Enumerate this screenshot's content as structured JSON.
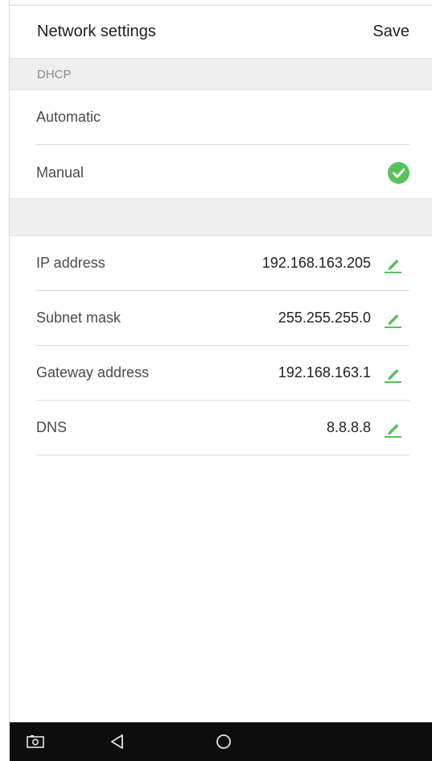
{
  "header": {
    "title": "Network settings",
    "save_label": "Save"
  },
  "dhcp_section": {
    "label": "DHCP",
    "options": [
      {
        "label": "Automatic",
        "selected": false
      },
      {
        "label": "Manual",
        "selected": true
      }
    ]
  },
  "network_fields": [
    {
      "label": "IP address",
      "value": "192.168.163.205"
    },
    {
      "label": "Subnet mask",
      "value": "255.255.255.0"
    },
    {
      "label": "Gateway address",
      "value": "192.168.163.1"
    },
    {
      "label": "DNS",
      "value": "8.8.8.8"
    }
  ],
  "icons": {
    "selected_indicator": "check-circle-icon",
    "edit": "pencil-icon",
    "nav": [
      "screenshot-icon",
      "back-icon",
      "home-icon"
    ]
  },
  "colors": {
    "accent_green": "#57c15a",
    "section_bg": "#efefef",
    "navbar_bg": "#0d0d0d"
  }
}
